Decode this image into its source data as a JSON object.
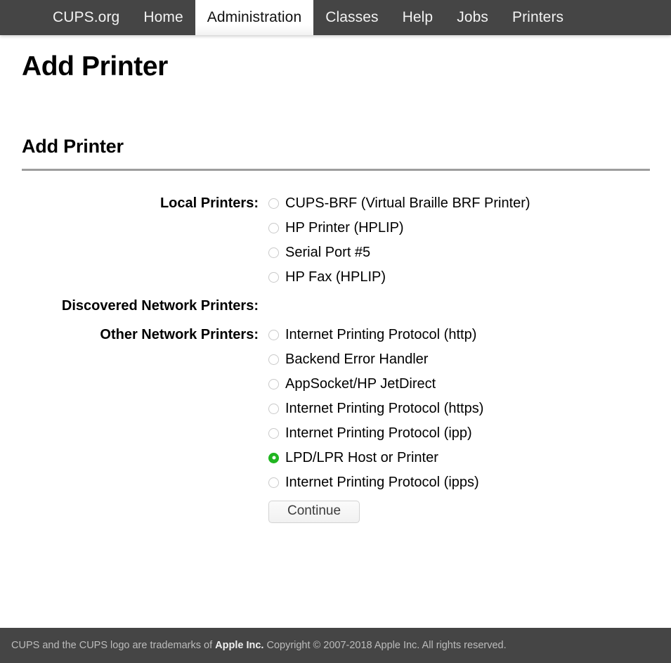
{
  "nav": {
    "items": [
      {
        "label": "CUPS.org",
        "active": false
      },
      {
        "label": "Home",
        "active": false
      },
      {
        "label": "Administration",
        "active": true
      },
      {
        "label": "Classes",
        "active": false
      },
      {
        "label": "Help",
        "active": false
      },
      {
        "label": "Jobs",
        "active": false
      },
      {
        "label": "Printers",
        "active": false
      }
    ]
  },
  "page": {
    "h1_title": "Add Printer",
    "h2_title": "Add Printer"
  },
  "form": {
    "groups": [
      {
        "key": "local_printers",
        "label": "Local Printers:",
        "options": [
          {
            "label": "CUPS-BRF (Virtual Braille BRF Printer)",
            "checked": false
          },
          {
            "label": "HP Printer (HPLIP)",
            "checked": false
          },
          {
            "label": "Serial Port #5",
            "checked": false
          },
          {
            "label": "HP Fax (HPLIP)",
            "checked": false
          }
        ]
      },
      {
        "key": "discovered_network_printers",
        "label": "Discovered Network Printers:",
        "options": []
      },
      {
        "key": "other_network_printers",
        "label": "Other Network Printers:",
        "options": [
          {
            "label": "Internet Printing Protocol (http)",
            "checked": false
          },
          {
            "label": "Backend Error Handler",
            "checked": false
          },
          {
            "label": "AppSocket/HP JetDirect",
            "checked": false
          },
          {
            "label": "Internet Printing Protocol (https)",
            "checked": false
          },
          {
            "label": "Internet Printing Protocol (ipp)",
            "checked": false
          },
          {
            "label": "LPD/LPR Host or Printer",
            "checked": true
          },
          {
            "label": "Internet Printing Protocol (ipps)",
            "checked": false
          }
        ]
      }
    ],
    "continue_label": "Continue"
  },
  "footer": {
    "text_before": "CUPS and the CUPS logo are trademarks of ",
    "link_label": "Apple Inc.",
    "text_after": " Copyright © 2007-2018 Apple Inc. All rights reserved."
  },
  "colors": {
    "nav_background": "#454545",
    "footer_background": "#454545",
    "accent_selected_radio": "#22b422",
    "rule": "#9d9d9d"
  }
}
